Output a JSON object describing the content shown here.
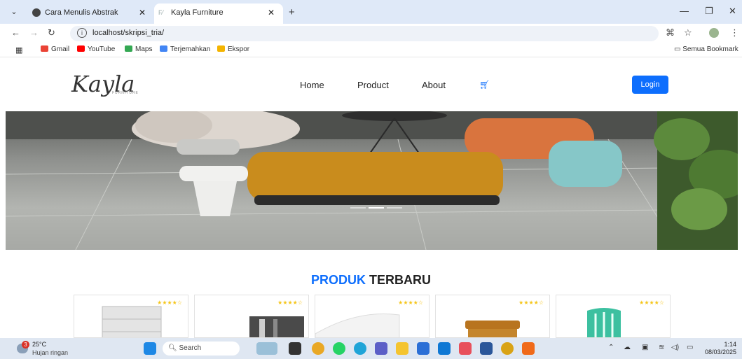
{
  "browser": {
    "tabs": [
      {
        "title": "Cara Menulis Abstrak",
        "active": false
      },
      {
        "title": "Kayla Furniture",
        "active": true
      }
    ],
    "url": "localhost/skripsi_tria/",
    "bookmarks": [
      {
        "label": "Gmail",
        "color": "#ea4335"
      },
      {
        "label": "YouTube",
        "color": "#ff0000"
      },
      {
        "label": "Maps",
        "color": "#34a853"
      },
      {
        "label": "Terjemahkan",
        "color": "#4285f4"
      },
      {
        "label": "Ekspor",
        "color": "#f4b400"
      }
    ],
    "bookmarks_folder": "Semua Bookmark"
  },
  "site": {
    "logo": "Kayla",
    "logo_sub": "FURNITURE",
    "nav": [
      "Home",
      "Product",
      "About"
    ],
    "cart_icon": "cart-icon",
    "login_label": "Login",
    "accent": "#0d6efd"
  },
  "hero": {
    "slides": 3,
    "active_slide": 2
  },
  "products": {
    "title_accent": "PRODUK",
    "title_rest": "TERBARU",
    "cards": [
      {
        "stars": "★★★★☆",
        "item": "drawer-cabinet"
      },
      {
        "stars": "★★★★☆",
        "item": "wardrobe"
      },
      {
        "stars": "★★★★☆",
        "item": "pillow"
      },
      {
        "stars": "★★★★☆",
        "item": "wooden-stool"
      },
      {
        "stars": "★★★★☆",
        "item": "plastic-chair"
      }
    ]
  },
  "taskbar": {
    "weather_temp": "25°C",
    "weather_desc": "Hujan ringan",
    "weather_badge": "3",
    "search_placeholder": "Search",
    "time": "1:14",
    "date": "08/03/2025"
  }
}
